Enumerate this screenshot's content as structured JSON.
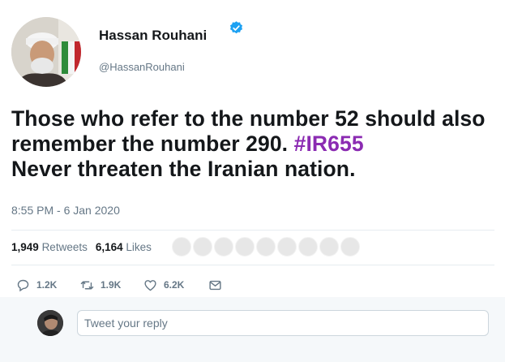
{
  "author": {
    "name": "Hassan Rouhani",
    "handle": "@HassanRouhani",
    "verified": true
  },
  "tweet": {
    "line1": "Those who refer to the number 52 should also",
    "line2_prefix": "remember the number 290. ",
    "hashtag": "#IR655",
    "line3": "Never threaten the Iranian nation.",
    "timestamp": "8:55 PM - 6 Jan 2020"
  },
  "stats": {
    "retweets_count": "1,949",
    "retweets_label": "Retweets",
    "likes_count": "6,164",
    "likes_label": "Likes"
  },
  "actions": {
    "reply_count": "1.2K",
    "retweet_count": "1.9K",
    "like_count": "6.2K"
  },
  "reply": {
    "placeholder": "Tweet your reply"
  },
  "colors": {
    "hashtag": "#8b2bb2",
    "verified": "#1da1f2",
    "secondary_text": "#657786"
  },
  "icons": [
    "verified-icon",
    "reply-icon",
    "retweet-icon",
    "like-icon",
    "dm-icon"
  ]
}
